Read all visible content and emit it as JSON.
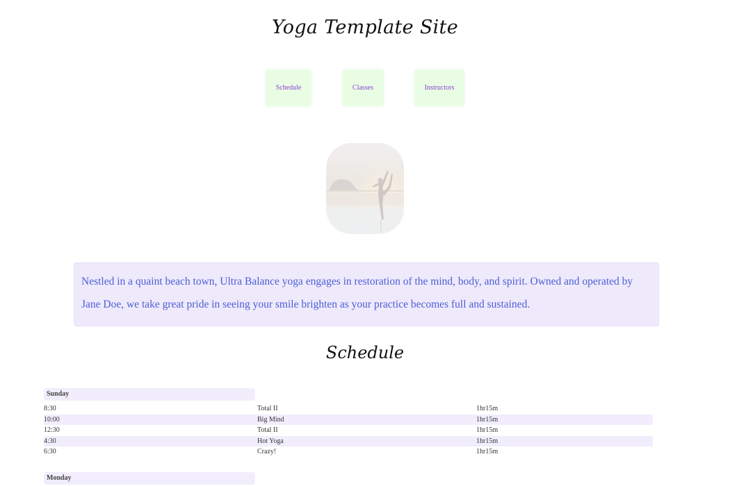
{
  "site": {
    "title": "Yoga Template Site"
  },
  "nav": {
    "schedule": "Schedule",
    "classes": "Classes",
    "instructors": "Instructors"
  },
  "hero": {
    "image_description": "yoga-silhouette-photo"
  },
  "intro": {
    "text": "Nestled in a quaint beach town, Ultra Balance yoga engages in restoration of the mind, body, and spirit. Owned and operated by Jane Doe, we take great pride in seeing your smile brighten as your practice becomes full and sustained."
  },
  "schedule": {
    "title": "Schedule",
    "days": [
      {
        "name": "Sunday",
        "rows": [
          {
            "time": "8:30",
            "class": "Total II",
            "duration": "1hr15m"
          },
          {
            "time": "10:00",
            "class": "Big Mind",
            "duration": "1hr15m"
          },
          {
            "time": "12:30",
            "class": "Total II",
            "duration": "1hr15m"
          },
          {
            "time": "4:30",
            "class": "Hot Yoga",
            "duration": "1hr15m"
          },
          {
            "time": "6:30",
            "class": "Crazy!",
            "duration": "1hr15m"
          }
        ]
      },
      {
        "name": "Monday",
        "rows": []
      }
    ]
  },
  "colors": {
    "nav_bg": "#e9fde5",
    "nav_text": "#8a3fd1",
    "intro_bg": "#efe9fc",
    "intro_text": "#4b5fd4",
    "row_alt_bg": "#f1edfc"
  }
}
